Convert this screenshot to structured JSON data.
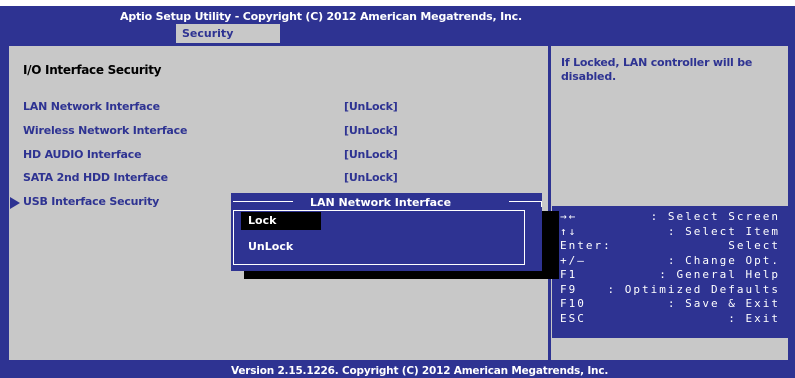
{
  "window": {
    "title": "Aptio Setup Utility - Copyright (C) 2012 American Megatrends, Inc.",
    "active_tab": "Security"
  },
  "main": {
    "heading": "I/O Interface Security",
    "items": [
      {
        "label": "LAN Network Interface",
        "value": "[UnLock]"
      },
      {
        "label": "Wireless Network Interface",
        "value": "[UnLock]"
      },
      {
        "label": "HD AUDIO Interface",
        "value": "[UnLock]"
      },
      {
        "label": "SATA 2nd HDD Interface",
        "value": "[UnLock]"
      },
      {
        "label": "USB Interface Security",
        "submenu": true
      }
    ]
  },
  "help": {
    "text": "If Locked, LAN controller will be disabled."
  },
  "keys": [
    {
      "key": "→←",
      "desc": ": Select Screen"
    },
    {
      "key": "↑↓",
      "desc": ": Select Item"
    },
    {
      "key": "Enter:",
      "desc": "Select"
    },
    {
      "key": "+/—",
      "desc": ": Change Opt."
    },
    {
      "key": "F1",
      "desc": ": General Help"
    },
    {
      "key": "F9",
      "desc": ": Optimized Defaults"
    },
    {
      "key": "F10",
      "desc": ": Save & Exit"
    },
    {
      "key": "ESC",
      "desc": ": Exit"
    }
  ],
  "popup": {
    "title": "LAN Network Interface",
    "options": [
      "Lock",
      "UnLock"
    ],
    "selected": "Lock"
  },
  "footer": {
    "text": "Version 2.15.1226. Copyright (C) 2012 American Megatrends, Inc."
  },
  "colors": {
    "frame_blue": "#2e3392",
    "panel_gray": "#c8c8c8",
    "highlight_black": "#000000",
    "text_white": "#ffffff"
  }
}
